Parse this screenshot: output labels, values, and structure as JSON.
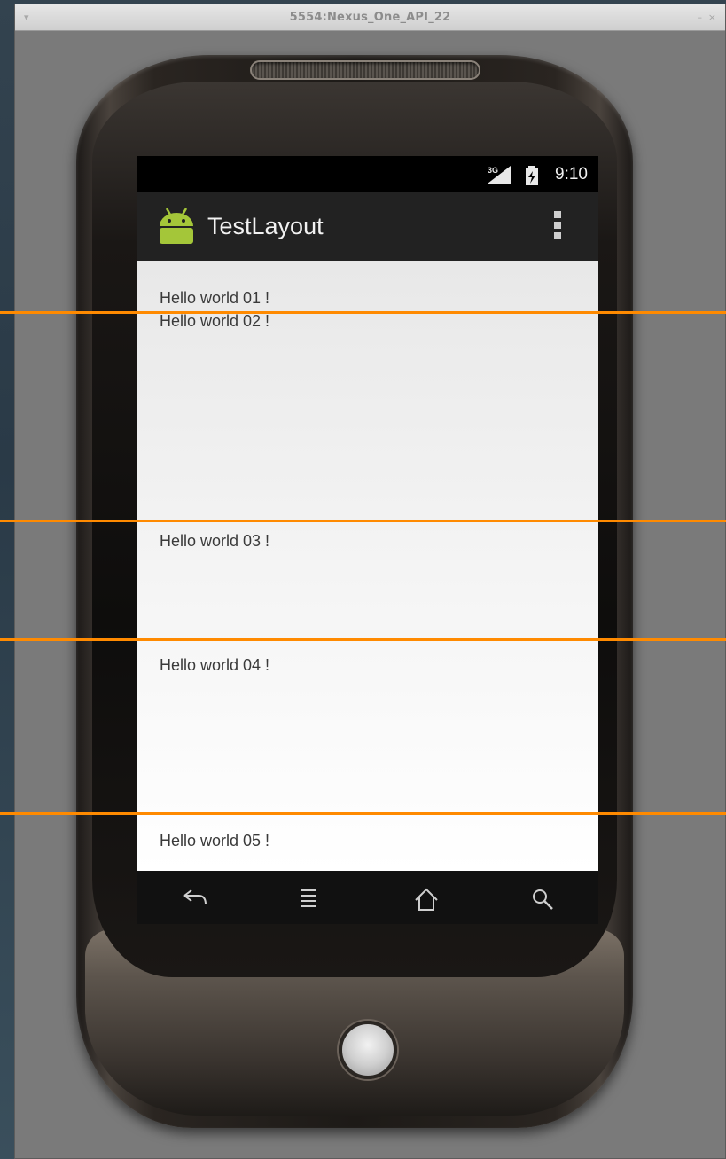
{
  "window": {
    "title": "5554:Nexus_One_API_22",
    "menu_glyph": "▾",
    "minimize_glyph": "–",
    "close_glyph": "×"
  },
  "status_bar": {
    "network_label": "3G",
    "time": "9:10"
  },
  "action_bar": {
    "app_title": "TestLayout",
    "app_icon": "android-robot-icon",
    "overflow_icon": "overflow-menu-icon"
  },
  "content": {
    "items": [
      "Hello world 01 !",
      "Hello world 02 !",
      "Hello world 03 !",
      "Hello world 04 !",
      "Hello world 05 !"
    ]
  },
  "nav_keys": [
    "back-icon",
    "menu-icon",
    "home-icon",
    "search-icon"
  ],
  "colors": {
    "guide_line": "#ff8a00",
    "action_bar": "#222222",
    "android_green": "#a4c639"
  }
}
